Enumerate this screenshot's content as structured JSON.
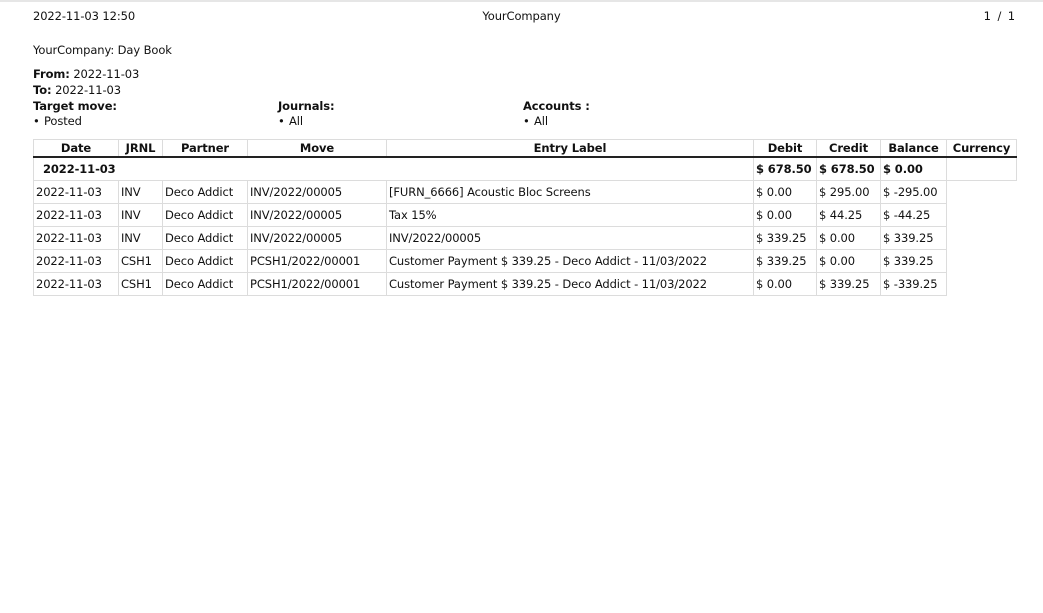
{
  "header": {
    "printed_at": "2022-11-03 12:50",
    "company": "YourCompany",
    "page_indicator": "1 / 1"
  },
  "report": {
    "title": "YourCompany: Day Book",
    "from_label": "From:",
    "from_value": "2022-11-03",
    "to_label": "To:",
    "to_value": "2022-11-03",
    "filters": {
      "target_move": {
        "label": "Target move:",
        "bullet": "•",
        "value": "Posted"
      },
      "journals": {
        "label": "Journals:",
        "bullet": "•",
        "value": "All"
      },
      "accounts": {
        "label": "Accounts :",
        "bullet": "•",
        "value": "All"
      }
    }
  },
  "table": {
    "columns": [
      "Date",
      "JRNL",
      "Partner",
      "Move",
      "Entry Label",
      "Debit",
      "Credit",
      "Balance",
      "Currency"
    ],
    "group": {
      "date": "2022-11-03",
      "debit": "$ 678.50",
      "credit": "$ 678.50",
      "balance": "$ 0.00"
    },
    "rows": [
      {
        "date": "2022-11-03",
        "jrnl": "INV",
        "partner": "Deco Addict",
        "move": "INV/2022/00005",
        "label": "[FURN_6666] Acoustic Bloc Screens",
        "debit": "$ 0.00",
        "credit": "$ 295.00",
        "balance": "$ -295.00"
      },
      {
        "date": "2022-11-03",
        "jrnl": "INV",
        "partner": "Deco Addict",
        "move": "INV/2022/00005",
        "label": "Tax 15%",
        "debit": "$ 0.00",
        "credit": "$ 44.25",
        "balance": "$ -44.25"
      },
      {
        "date": "2022-11-03",
        "jrnl": "INV",
        "partner": "Deco Addict",
        "move": "INV/2022/00005",
        "label": "INV/2022/00005",
        "debit": "$ 339.25",
        "credit": "$ 0.00",
        "balance": "$ 339.25"
      },
      {
        "date": "2022-11-03",
        "jrnl": "CSH1",
        "partner": "Deco Addict",
        "move": "PCSH1/2022/00001",
        "label": "Customer Payment $ 339.25 - Deco Addict - 11/03/2022",
        "debit": "$ 339.25",
        "credit": "$ 0.00",
        "balance": "$ 339.25"
      },
      {
        "date": "2022-11-03",
        "jrnl": "CSH1",
        "partner": "Deco Addict",
        "move": "PCSH1/2022/00001",
        "label": "Customer Payment $ 339.25 - Deco Addict - 11/03/2022",
        "debit": "$ 0.00",
        "credit": "$ 339.25",
        "balance": "$ -339.25"
      }
    ]
  }
}
